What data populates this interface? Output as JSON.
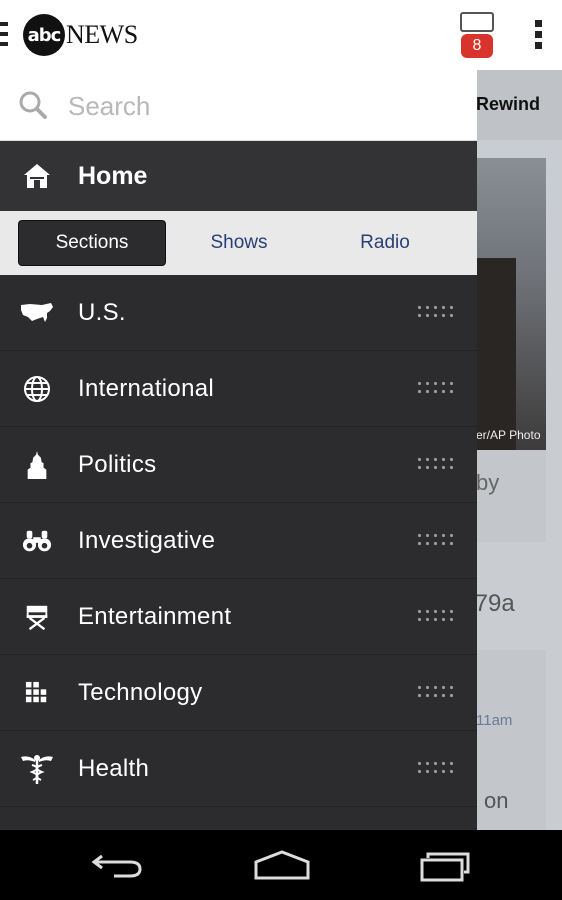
{
  "app": {
    "logo_circle": "abc",
    "logo_text": "NEWS",
    "inbox_count": "8"
  },
  "background": {
    "tab_label": "Rewind",
    "photo_credit": "er/AP Photo",
    "text_fragment_1": "by",
    "text_fragment_2": "f79a",
    "time_fragment": "11am",
    "text_fragment_3": "on"
  },
  "drawer": {
    "search_placeholder": "Search",
    "home_label": "Home",
    "segments": [
      {
        "label": "Sections",
        "active": true
      },
      {
        "label": "Shows",
        "active": false
      },
      {
        "label": "Radio",
        "active": false
      }
    ],
    "items": [
      {
        "label": "U.S.",
        "icon": "us-map-icon"
      },
      {
        "label": "International",
        "icon": "globe-icon"
      },
      {
        "label": "Politics",
        "icon": "capitol-icon"
      },
      {
        "label": "Investigative",
        "icon": "binoculars-icon"
      },
      {
        "label": "Entertainment",
        "icon": "directors-chair-icon"
      },
      {
        "label": "Technology",
        "icon": "grid-icon"
      },
      {
        "label": "Health",
        "icon": "caduceus-icon"
      }
    ]
  },
  "nav": {
    "back_icon": "back-icon",
    "home_icon": "home-nav-icon",
    "recents_icon": "recent-apps-icon"
  }
}
